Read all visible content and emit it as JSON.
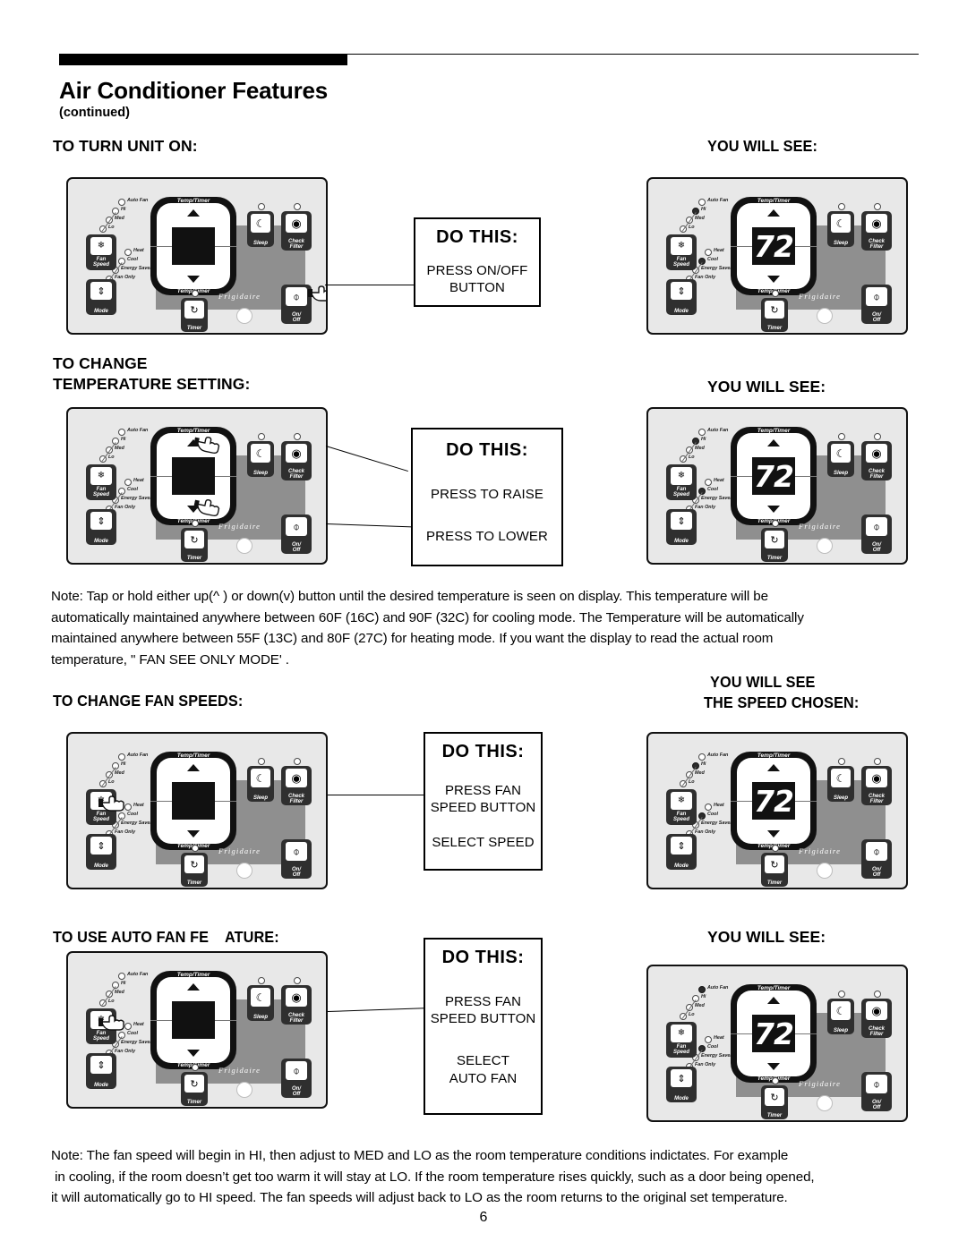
{
  "header": {
    "title": "Air Conditioner Features",
    "subtitle": "(continued)"
  },
  "sections": [
    {
      "heading": "TO TURN UNIT ON:",
      "right_heading": "YOU WILL SEE:",
      "do_this": {
        "title": "DO THIS:",
        "lines": [
          "PRESS ON/OFF",
          "BUTTON"
        ]
      }
    },
    {
      "heading_line1": "TO CHANGE",
      "heading_line2": "TEMPERATURE SETTING:",
      "right_heading": "YOU WILL SEE:",
      "do_this": {
        "title": "DO THIS:",
        "lines": [
          "PRESS TO RAISE",
          "PRESS TO LOWER"
        ]
      }
    },
    {
      "heading": "TO CHANGE FAN SPEEDS:",
      "right_heading_line1": "YOU WILL SEE",
      "right_heading_line2": "THE SPEED CHOSEN:",
      "do_this": {
        "title": "DO THIS:",
        "lines": [
          "PRESS FAN",
          "SPEED BUTTON",
          "SELECT SPEED"
        ]
      }
    },
    {
      "heading": "TO USE AUTO FAN FE    ATURE:",
      "right_heading": "YOU WILL SEE:",
      "do_this": {
        "title": "DO THIS:",
        "lines": [
          "PRESS FAN",
          "SPEED BUTTON",
          "SELECT",
          "AUTO FAN"
        ]
      }
    }
  ],
  "notes": {
    "temperature": [
      "Note: Tap or hold either up(^ ) or down(v) button until the desired temperature is seen on display. This temperature will be",
      "automatically maintained anywhere between 60F (16C) and 90F (32C) for cooling mode. The Temperature will be automatically",
      "maintained anywhere between 55F (13C) and 80F (27C) for heating mode. If you want the display to read the actual room",
      "temperature, \" FAN SEE ONLY MODE' ."
    ],
    "fan_speed": [
      "Note: The fan speed will begin in HI, then adjust to MED and LO as the room temperature conditions indictates. For example",
      " in cooling, if the room doesn’t get too warm it will stay at LO. If the room temperature rises quickly, such as a door being opened,",
      "it will automatically go to HI speed. The fan speeds will adjust back to LO as the room returns to the original set temperature."
    ]
  },
  "control_panel": {
    "display_label_top": "Temp/Timer",
    "display_label_bottom": "Temp/Timer",
    "brand": "Frigidaire",
    "fan_leds": [
      "Auto Fan",
      "Hi",
      "Med",
      "Lo"
    ],
    "mode_leds": [
      "Heat",
      "Cool",
      "Energy Saver",
      "Fan Only"
    ],
    "buttons": {
      "fan_speed": "Fan\nSpeed",
      "fan_speed_l1": "Fan",
      "fan_speed_l2": "Speed",
      "mode": "Mode",
      "sleep": "Sleep",
      "check_filter_l1": "Check",
      "check_filter_l2": "Filter",
      "timer": "Timer",
      "on_off_l1": "On/",
      "on_off_l2": "Off"
    },
    "display_value": "72",
    "blank_display": ""
  },
  "page_number": "6"
}
